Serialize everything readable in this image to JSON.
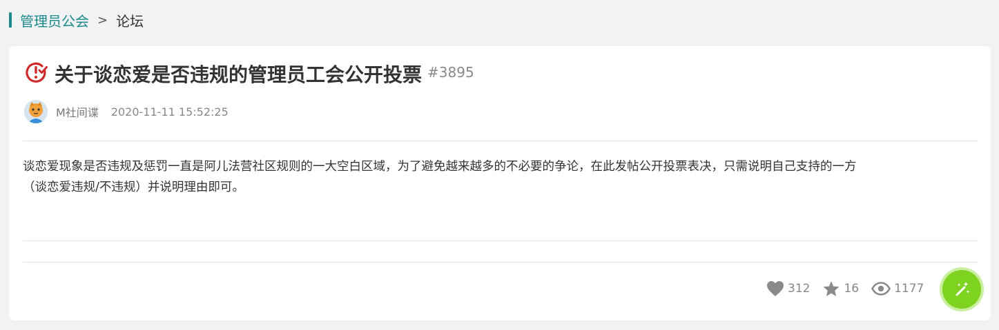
{
  "breadcrumb": {
    "parent": "管理员公会",
    "separator": ">",
    "current": "论坛"
  },
  "post": {
    "title": "关于谈恋爱是否违规的管理员工会公开投票",
    "id": "#3895",
    "author": "M社间谍",
    "timestamp": "2020-11-11 15:52:25",
    "body_line1": "谈恋爱现象是否违规及惩罚一直是阿儿法营社区规则的一大空白区域，为了避免越来越多的不必要的争论，在此发帖公开投票表决，只需说明自己支持的一方",
    "body_line2": "（谈恋爱违规/不违规）并说明理由即可。"
  },
  "stats": {
    "likes": "312",
    "stars": "16",
    "views": "1177"
  },
  "colors": {
    "accent": "#1a8a8a",
    "alert_red": "#d0292c",
    "fab_green": "#7ed321",
    "icon_gray": "#8a8a8a"
  },
  "icons": {
    "title": "alert-clock-icon",
    "like": "heart-icon",
    "star": "star-icon",
    "view": "eye-icon",
    "fab": "magic-wand-icon"
  }
}
